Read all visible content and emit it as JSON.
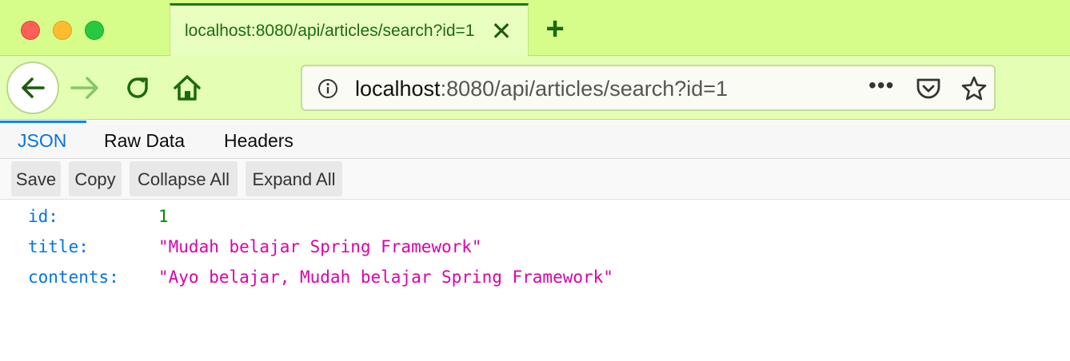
{
  "window": {
    "controls": [
      "close",
      "minimize",
      "zoom"
    ],
    "colors": {
      "close": "#fe5f57",
      "minimize": "#febc2e",
      "zoom": "#28c840"
    }
  },
  "tab": {
    "title": "localhost:8080/api/articles/search?id=1",
    "close_icon": "close-icon",
    "new_tab_icon": "plus-icon"
  },
  "toolbar": {
    "back_icon": "arrow-left-icon",
    "forward_icon": "arrow-right-icon",
    "reload_icon": "reload-icon",
    "home_icon": "home-icon"
  },
  "urlbar": {
    "host": "localhost",
    "rest": ":8080/api/articles/search?id=1",
    "info_icon": "info-icon",
    "more_icon": "more-icon",
    "pocket_icon": "pocket-icon",
    "star_icon": "star-icon"
  },
  "viewer": {
    "tabs": [
      {
        "label": "JSON",
        "active": true
      },
      {
        "label": "Raw Data",
        "active": false
      },
      {
        "label": "Headers",
        "active": false
      }
    ],
    "buttons": [
      "Save",
      "Copy",
      "Collapse All",
      "Expand All"
    ]
  },
  "json": {
    "rows": [
      {
        "key": "id:",
        "value": "1",
        "type": "number"
      },
      {
        "key": "title:",
        "value": "\"Mudah belajar Spring Framework\"",
        "type": "string"
      },
      {
        "key": "contents:",
        "value": "\"Ayo belajar, Mudah belajar Spring Framework\"",
        "type": "string"
      }
    ]
  },
  "colors": {
    "tabstrip": "#d6fc8a",
    "toolbar": "#e4ffb3",
    "accent": "#0a84ff",
    "key": "#0074e8",
    "number": "#058b00",
    "string": "#dd00a9"
  }
}
